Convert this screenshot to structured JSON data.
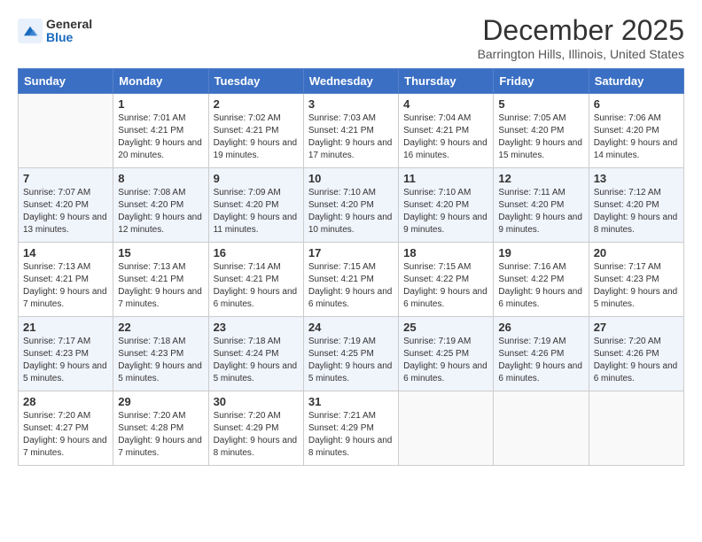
{
  "logo": {
    "general": "General",
    "blue": "Blue"
  },
  "header": {
    "month": "December 2025",
    "location": "Barrington Hills, Illinois, United States"
  },
  "weekdays": [
    "Sunday",
    "Monday",
    "Tuesday",
    "Wednesday",
    "Thursday",
    "Friday",
    "Saturday"
  ],
  "weeks": [
    [
      {
        "day": "",
        "info": ""
      },
      {
        "day": "1",
        "info": "Sunrise: 7:01 AM\nSunset: 4:21 PM\nDaylight: 9 hours\nand 20 minutes."
      },
      {
        "day": "2",
        "info": "Sunrise: 7:02 AM\nSunset: 4:21 PM\nDaylight: 9 hours\nand 19 minutes."
      },
      {
        "day": "3",
        "info": "Sunrise: 7:03 AM\nSunset: 4:21 PM\nDaylight: 9 hours\nand 17 minutes."
      },
      {
        "day": "4",
        "info": "Sunrise: 7:04 AM\nSunset: 4:21 PM\nDaylight: 9 hours\nand 16 minutes."
      },
      {
        "day": "5",
        "info": "Sunrise: 7:05 AM\nSunset: 4:20 PM\nDaylight: 9 hours\nand 15 minutes."
      },
      {
        "day": "6",
        "info": "Sunrise: 7:06 AM\nSunset: 4:20 PM\nDaylight: 9 hours\nand 14 minutes."
      }
    ],
    [
      {
        "day": "7",
        "info": "Sunrise: 7:07 AM\nSunset: 4:20 PM\nDaylight: 9 hours\nand 13 minutes."
      },
      {
        "day": "8",
        "info": "Sunrise: 7:08 AM\nSunset: 4:20 PM\nDaylight: 9 hours\nand 12 minutes."
      },
      {
        "day": "9",
        "info": "Sunrise: 7:09 AM\nSunset: 4:20 PM\nDaylight: 9 hours\nand 11 minutes."
      },
      {
        "day": "10",
        "info": "Sunrise: 7:10 AM\nSunset: 4:20 PM\nDaylight: 9 hours\nand 10 minutes."
      },
      {
        "day": "11",
        "info": "Sunrise: 7:10 AM\nSunset: 4:20 PM\nDaylight: 9 hours\nand 9 minutes."
      },
      {
        "day": "12",
        "info": "Sunrise: 7:11 AM\nSunset: 4:20 PM\nDaylight: 9 hours\nand 9 minutes."
      },
      {
        "day": "13",
        "info": "Sunrise: 7:12 AM\nSunset: 4:20 PM\nDaylight: 9 hours\nand 8 minutes."
      }
    ],
    [
      {
        "day": "14",
        "info": "Sunrise: 7:13 AM\nSunset: 4:21 PM\nDaylight: 9 hours\nand 7 minutes."
      },
      {
        "day": "15",
        "info": "Sunrise: 7:13 AM\nSunset: 4:21 PM\nDaylight: 9 hours\nand 7 minutes."
      },
      {
        "day": "16",
        "info": "Sunrise: 7:14 AM\nSunset: 4:21 PM\nDaylight: 9 hours\nand 6 minutes."
      },
      {
        "day": "17",
        "info": "Sunrise: 7:15 AM\nSunset: 4:21 PM\nDaylight: 9 hours\nand 6 minutes."
      },
      {
        "day": "18",
        "info": "Sunrise: 7:15 AM\nSunset: 4:22 PM\nDaylight: 9 hours\nand 6 minutes."
      },
      {
        "day": "19",
        "info": "Sunrise: 7:16 AM\nSunset: 4:22 PM\nDaylight: 9 hours\nand 6 minutes."
      },
      {
        "day": "20",
        "info": "Sunrise: 7:17 AM\nSunset: 4:23 PM\nDaylight: 9 hours\nand 5 minutes."
      }
    ],
    [
      {
        "day": "21",
        "info": "Sunrise: 7:17 AM\nSunset: 4:23 PM\nDaylight: 9 hours\nand 5 minutes."
      },
      {
        "day": "22",
        "info": "Sunrise: 7:18 AM\nSunset: 4:23 PM\nDaylight: 9 hours\nand 5 minutes."
      },
      {
        "day": "23",
        "info": "Sunrise: 7:18 AM\nSunset: 4:24 PM\nDaylight: 9 hours\nand 5 minutes."
      },
      {
        "day": "24",
        "info": "Sunrise: 7:19 AM\nSunset: 4:25 PM\nDaylight: 9 hours\nand 5 minutes."
      },
      {
        "day": "25",
        "info": "Sunrise: 7:19 AM\nSunset: 4:25 PM\nDaylight: 9 hours\nand 6 minutes."
      },
      {
        "day": "26",
        "info": "Sunrise: 7:19 AM\nSunset: 4:26 PM\nDaylight: 9 hours\nand 6 minutes."
      },
      {
        "day": "27",
        "info": "Sunrise: 7:20 AM\nSunset: 4:26 PM\nDaylight: 9 hours\nand 6 minutes."
      }
    ],
    [
      {
        "day": "28",
        "info": "Sunrise: 7:20 AM\nSunset: 4:27 PM\nDaylight: 9 hours\nand 7 minutes."
      },
      {
        "day": "29",
        "info": "Sunrise: 7:20 AM\nSunset: 4:28 PM\nDaylight: 9 hours\nand 7 minutes."
      },
      {
        "day": "30",
        "info": "Sunrise: 7:20 AM\nSunset: 4:29 PM\nDaylight: 9 hours\nand 8 minutes."
      },
      {
        "day": "31",
        "info": "Sunrise: 7:21 AM\nSunset: 4:29 PM\nDaylight: 9 hours\nand 8 minutes."
      },
      {
        "day": "",
        "info": ""
      },
      {
        "day": "",
        "info": ""
      },
      {
        "day": "",
        "info": ""
      }
    ]
  ]
}
